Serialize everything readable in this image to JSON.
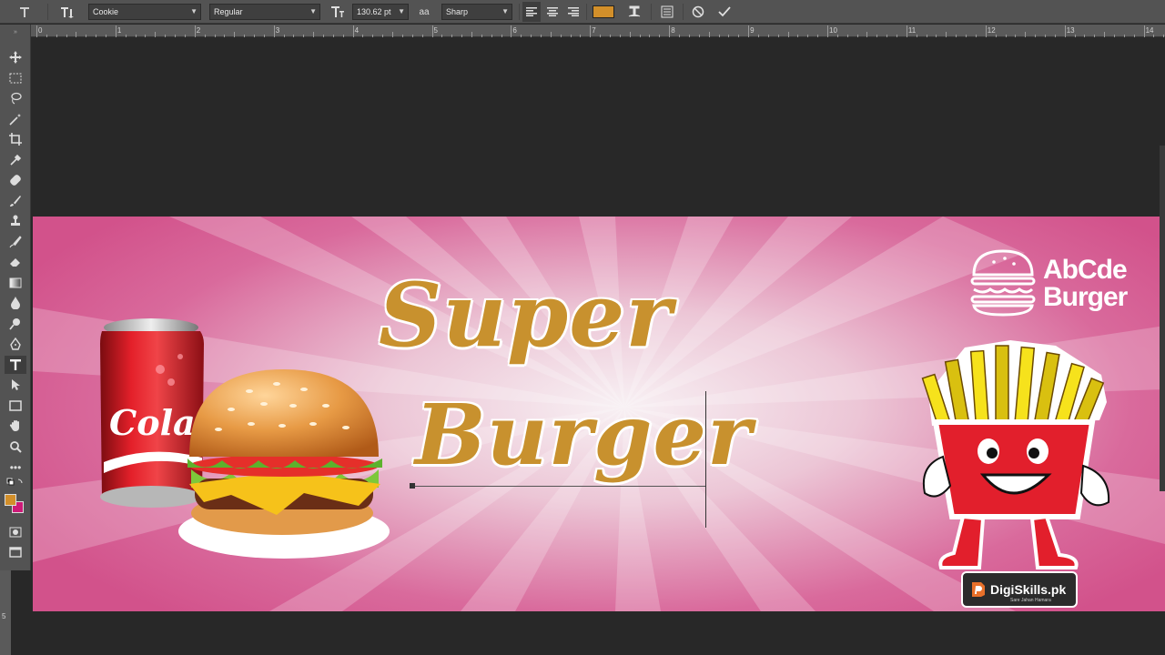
{
  "options_bar": {
    "font_family": "Cookie",
    "font_style": "Regular",
    "font_size": "130.62 pt",
    "aa_label": "aa",
    "antialias": "Sharp",
    "text_color": "#d28f2a"
  },
  "ruler": {
    "numbers": [
      "0",
      "1",
      "2",
      "3",
      "4",
      "5",
      "6",
      "7",
      "8",
      "9",
      "10",
      "11",
      "12",
      "13",
      "14"
    ],
    "side_number": "5"
  },
  "canvas": {
    "headline_line1": "Super",
    "headline_line2": "Burger",
    "brand_line1": "AbCde",
    "brand_line2": "Burger",
    "can_label": "Cola",
    "watermark": "DigiSkills.pk",
    "watermark_sub": "Sare Jahan Hamara"
  },
  "colors": {
    "banner_pink": "#d2528b",
    "headline_gold": "#c8912e",
    "ui_panel": "#535353"
  }
}
